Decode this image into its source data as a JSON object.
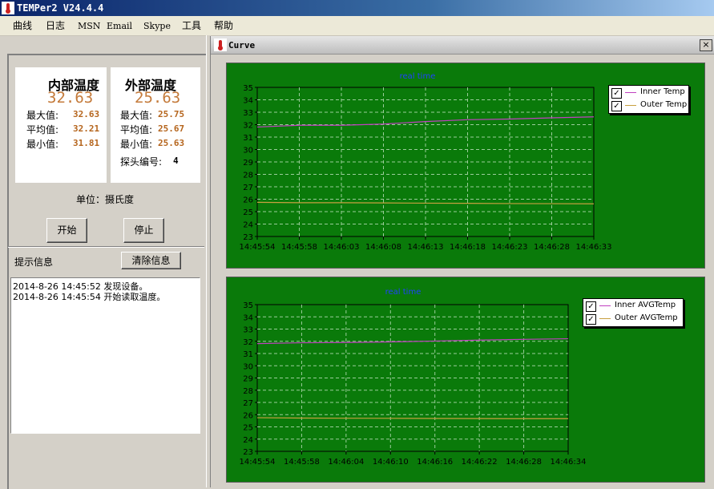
{
  "window": {
    "title": "TEMPer2 V24.4.4"
  },
  "menu": [
    "曲线",
    "日志",
    "MSN",
    "Email",
    "Skype",
    "工具",
    "帮助"
  ],
  "inner": {
    "title": "内部温度",
    "current": "32.63",
    "max_label": "最大值:",
    "max": "32.63",
    "avg_label": "平均值:",
    "avg": "32.21",
    "min_label": "最小值:",
    "min": "31.81"
  },
  "outer": {
    "title": "外部温度",
    "current": "25.63",
    "max_label": "最大值:",
    "max": "25.75",
    "avg_label": "平均值:",
    "avg": "25.67",
    "min_label": "最小值:",
    "min": "25.63",
    "probe_label": "探头编号:",
    "probe": "4"
  },
  "unit_label": "单位：摄氏度",
  "buttons": {
    "start": "开始",
    "stop": "停止",
    "clear": "清除信息"
  },
  "hint_label": "提示信息",
  "log": [
    "2014-8-26 14:45:52 发现设备。",
    "2014-8-26 14:45:54 开始读取温度。"
  ],
  "curve_window": {
    "title": "Curve",
    "close": "×"
  },
  "colors": {
    "plot_bg": "#0a7a0a",
    "inner_line": "#c040c0",
    "outer_line": "#c8a040",
    "grid": "#9acd9a",
    "title_blue": "#2040ff"
  },
  "chart_data": [
    {
      "type": "line",
      "title": "real time",
      "categories": [
        "14:45:54",
        "14:45:58",
        "14:46:03",
        "14:46:08",
        "14:46:13",
        "14:46:18",
        "14:46:23",
        "14:46:28",
        "14:46:33"
      ],
      "ylim": [
        23,
        35
      ],
      "yticks": [
        23,
        24,
        25,
        26,
        27,
        28,
        29,
        30,
        31,
        32,
        33,
        34,
        35
      ],
      "grid": true,
      "legend": "top-right",
      "series": [
        {
          "name": "Inner Temp",
          "color": "#c040c0",
          "values": [
            31.81,
            31.95,
            31.95,
            32.05,
            32.25,
            32.4,
            32.45,
            32.55,
            32.63
          ]
        },
        {
          "name": "Outer Temp",
          "color": "#c8a040",
          "values": [
            25.75,
            25.72,
            25.72,
            25.7,
            25.68,
            25.67,
            25.65,
            25.64,
            25.63
          ]
        }
      ]
    },
    {
      "type": "line",
      "title": "real time",
      "categories": [
        "14:45:54",
        "14:45:58",
        "14:46:04",
        "14:46:10",
        "14:46:16",
        "14:46:22",
        "14:46:28",
        "14:46:34"
      ],
      "ylim": [
        23,
        35
      ],
      "yticks": [
        23,
        24,
        25,
        26,
        27,
        28,
        29,
        30,
        31,
        32,
        33,
        34,
        35
      ],
      "grid": true,
      "legend": "top-right",
      "series": [
        {
          "name": "Inner AVGTemp",
          "color": "#c040c0",
          "values": [
            31.81,
            31.88,
            31.9,
            31.95,
            32.02,
            32.1,
            32.16,
            32.21
          ]
        },
        {
          "name": "Outer AVGTemp",
          "color": "#c8a040",
          "values": [
            25.75,
            25.72,
            25.71,
            25.7,
            25.69,
            25.68,
            25.67,
            25.67
          ]
        }
      ]
    }
  ]
}
